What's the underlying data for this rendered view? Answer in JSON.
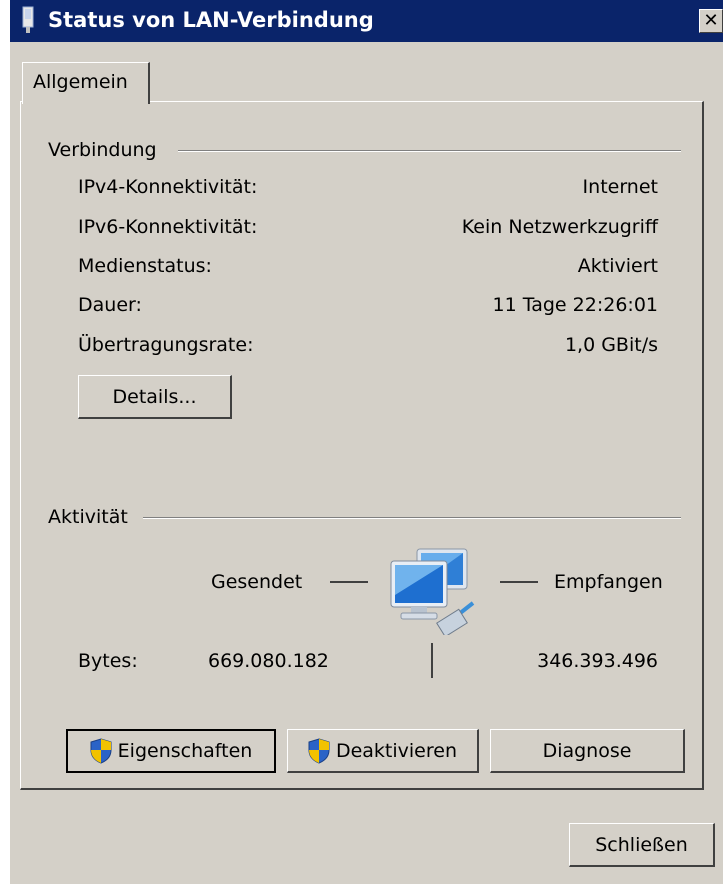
{
  "window": {
    "title": "Status von LAN-Verbindung",
    "close_glyph": "✕"
  },
  "tabs": [
    {
      "label": "Allgemein"
    }
  ],
  "connection": {
    "group_label": "Verbindung",
    "rows": [
      {
        "label": "IPv4-Konnektivität:",
        "value": "Internet"
      },
      {
        "label": "IPv6-Konnektivität:",
        "value": "Kein Netzwerkzugriff"
      },
      {
        "label": "Medienstatus:",
        "value": "Aktiviert"
      },
      {
        "label": "Dauer:",
        "value": "11 Tage 22:26:01"
      },
      {
        "label": "Übertragungsrate:",
        "value": "1,0 GBit/s"
      }
    ],
    "details_button": "Details..."
  },
  "activity": {
    "group_label": "Aktivität",
    "sent_label": "Gesendet",
    "received_label": "Empfangen",
    "bytes_label": "Bytes:",
    "bytes_sent": "669.080.182",
    "bytes_received": "346.393.496",
    "icon": "network-computers-icon"
  },
  "buttons": {
    "properties": "Eigenschaften",
    "disable": "Deaktivieren",
    "diagnose": "Diagnose",
    "close": "Schließen"
  },
  "colors": {
    "titlebar": "#0a246a",
    "window": "#d4d0c8",
    "shield_blue": "#2a63c7",
    "shield_yellow": "#f2c200"
  }
}
